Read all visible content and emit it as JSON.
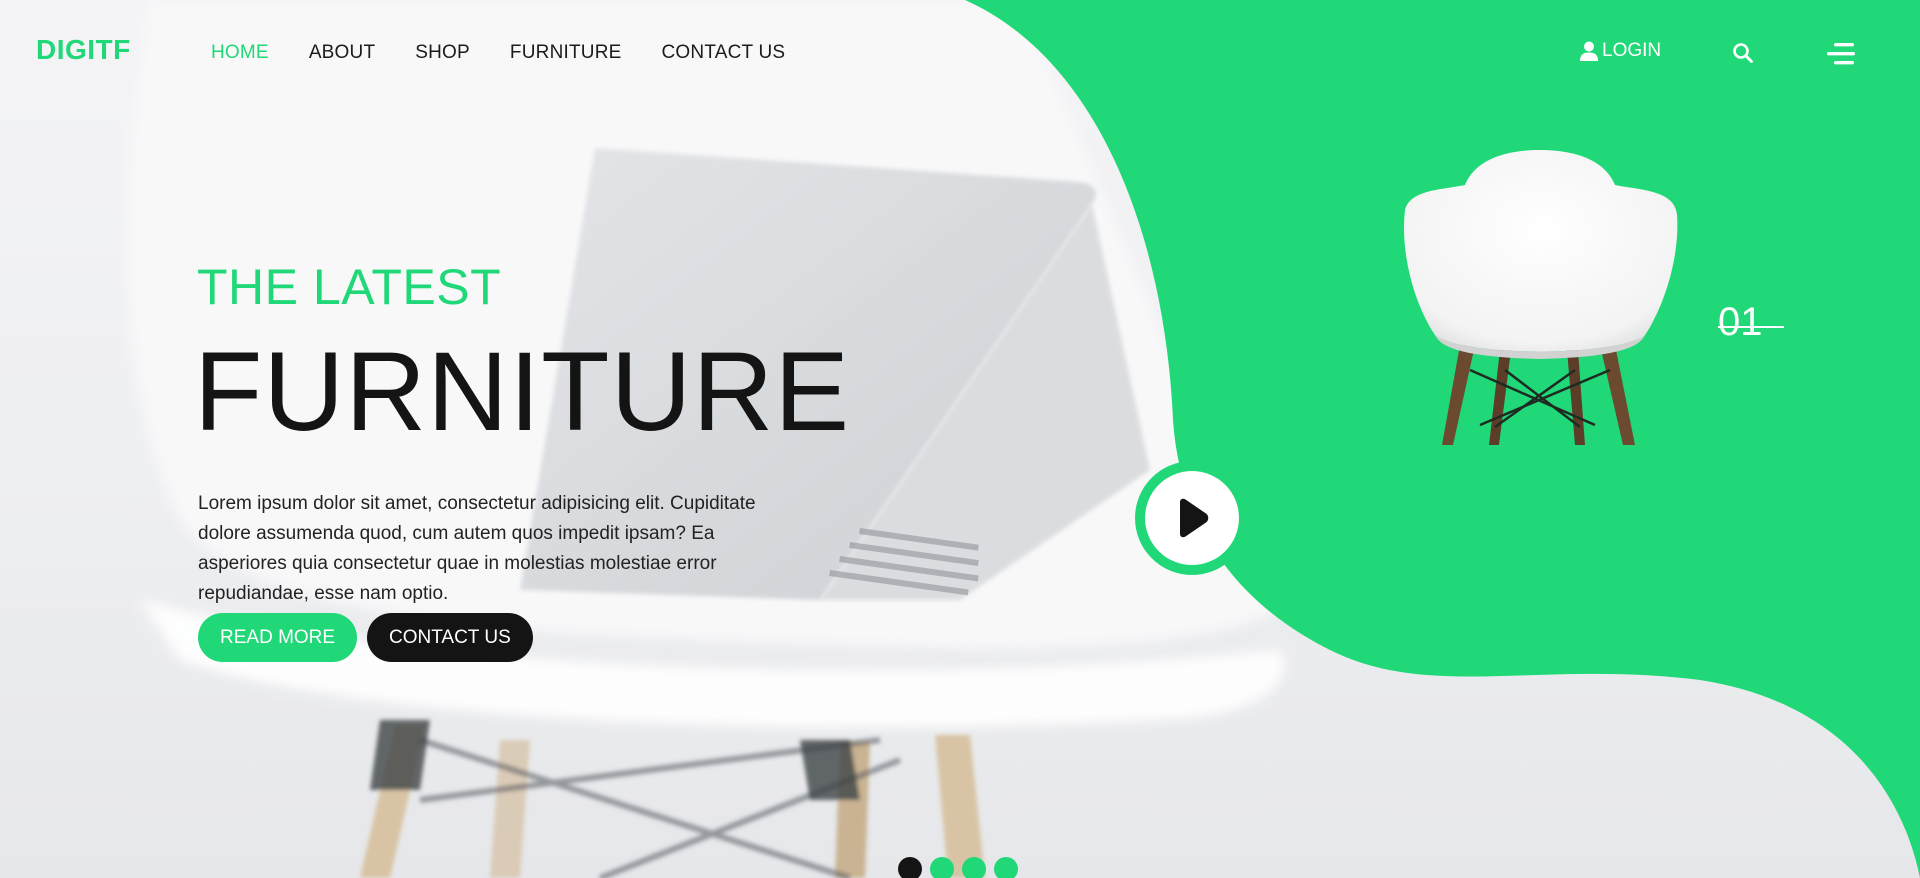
{
  "brand": {
    "logo": "DIGITF",
    "accent_color": "#21d878",
    "dark_color": "#141414"
  },
  "nav": {
    "items": [
      {
        "label": "HOME",
        "active": true
      },
      {
        "label": "ABOUT",
        "active": false
      },
      {
        "label": "SHOP",
        "active": false
      },
      {
        "label": "FURNITURE",
        "active": false
      },
      {
        "label": "CONTACT US",
        "active": false
      }
    ]
  },
  "header_actions": {
    "login_label": "LOGIN",
    "login_icon": "user-icon",
    "search_icon": "search-icon",
    "menu_icon": "menu-icon"
  },
  "hero": {
    "kicker": "THE LATEST",
    "headline": "FURNITURE",
    "description": "Lorem ipsum dolor sit amet, consectetur adipisicing elit. Cupiditate dolore assumenda quod, cum autem quos impedit ipsam? Ea asperiores quia consectetur quae in molestias molestiae error repudiandae, esse nam optio.",
    "read_more_label": "READ MORE",
    "contact_label": "CONTACT US",
    "play_icon": "play-icon"
  },
  "slider": {
    "current_number": "01",
    "dot_count": 4,
    "active_dot": 1
  }
}
